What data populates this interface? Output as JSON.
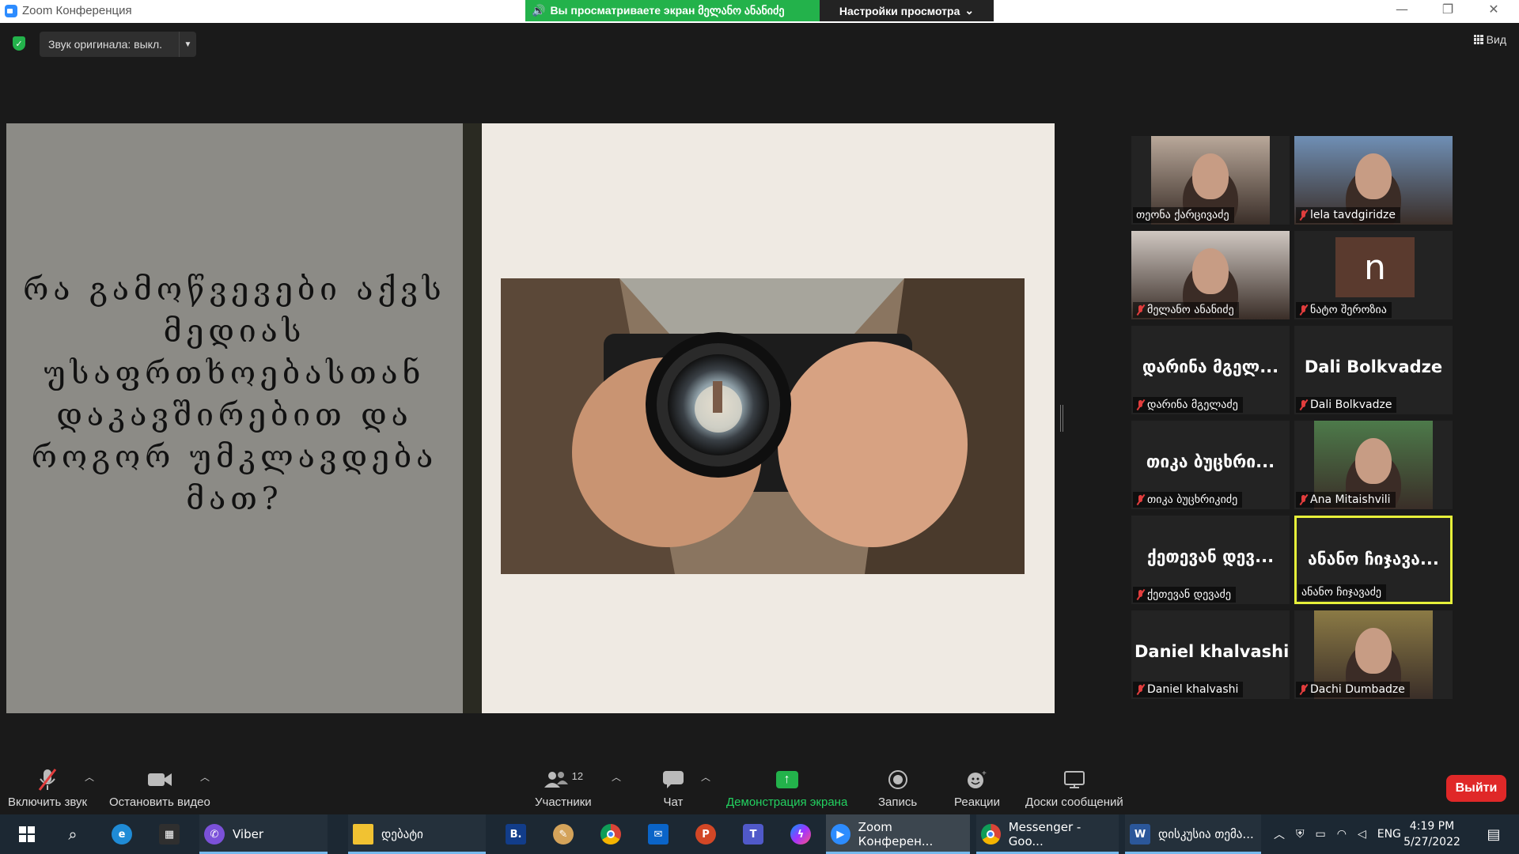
{
  "window": {
    "title": "Zoom Конференция",
    "share_banner": "Вы просматриваете экран მელანო ანანიძე",
    "view_options": "Настройки просмотра"
  },
  "top_controls": {
    "original_sound": "Звук оригинала: выкл.",
    "view": "Вид"
  },
  "slide": {
    "question": "რა გამოწვევები აქვს მედიას უსაფრთხოებასთან დაკავშირებით და როგორ უმკლავდება მათ?"
  },
  "participants": [
    {
      "big_name": "",
      "name": "თეონა ქარცივაძე",
      "muted": false,
      "video": true,
      "bg": "#b9a89a"
    },
    {
      "big_name": "",
      "name": "lela tavdgiridze",
      "muted": true,
      "video": true,
      "bg": "#6f8fb5"
    },
    {
      "big_name": "",
      "name": "მელანო ანანიძე",
      "muted": true,
      "video": true,
      "bg": "#cfc7c1"
    },
    {
      "big_name": "n",
      "name": "ნატო შეროზია",
      "muted": true,
      "video": false,
      "bg": "#5a3a2e"
    },
    {
      "big_name": "დარინა მგელ...",
      "name": "დარინა მგელაძე",
      "muted": true,
      "video": false,
      "bg": ""
    },
    {
      "big_name": "Dali Bolkvadze",
      "name": "Dali Bolkvadze",
      "muted": true,
      "video": false,
      "bg": ""
    },
    {
      "big_name": "თიკა ბუცხრი...",
      "name": "თიკა ბუცხრიკიძე",
      "muted": true,
      "video": false,
      "bg": ""
    },
    {
      "big_name": "",
      "name": "Ana Mitaishvili",
      "muted": true,
      "video": true,
      "bg": "#4d7a4a"
    },
    {
      "big_name": "ქეთევან დევ...",
      "name": "ქეთევან დევაძე",
      "muted": true,
      "video": false,
      "bg": ""
    },
    {
      "big_name": "ანანო ჩიჯავა...",
      "name": "ანანო ჩიჯავაძე",
      "muted": false,
      "video": false,
      "bg": "",
      "active": true
    },
    {
      "big_name": "Daniel khalvashi",
      "name": "Daniel khalvashi",
      "muted": true,
      "video": false,
      "bg": ""
    },
    {
      "big_name": "",
      "name": "Dachi Dumbadze",
      "muted": true,
      "video": true,
      "bg": "#8b7a45"
    }
  ],
  "toolbar": {
    "unmute": "Включить звук",
    "stop_video": "Остановить видео",
    "participants": "Участники",
    "participants_count": "12",
    "chat": "Чат",
    "share_screen": "Демонстрация экрана",
    "record": "Запись",
    "reactions": "Реакции",
    "whiteboards": "Доски сообщений",
    "leave": "Выйти"
  },
  "taskbar": {
    "viber": "Viber",
    "folder": "დებატი",
    "zoom": "Zoom Конферен...",
    "messenger": "Messenger - Goo...",
    "word": "დისკუსია თემა...",
    "lang": "ENG",
    "time": "4:19 PM",
    "date": "5/27/2022"
  },
  "colors": {
    "accent_green": "#23b24b",
    "leave_red": "#e02828",
    "active_speaker": "#e6f03a",
    "muted_red": "#e23d3d"
  }
}
